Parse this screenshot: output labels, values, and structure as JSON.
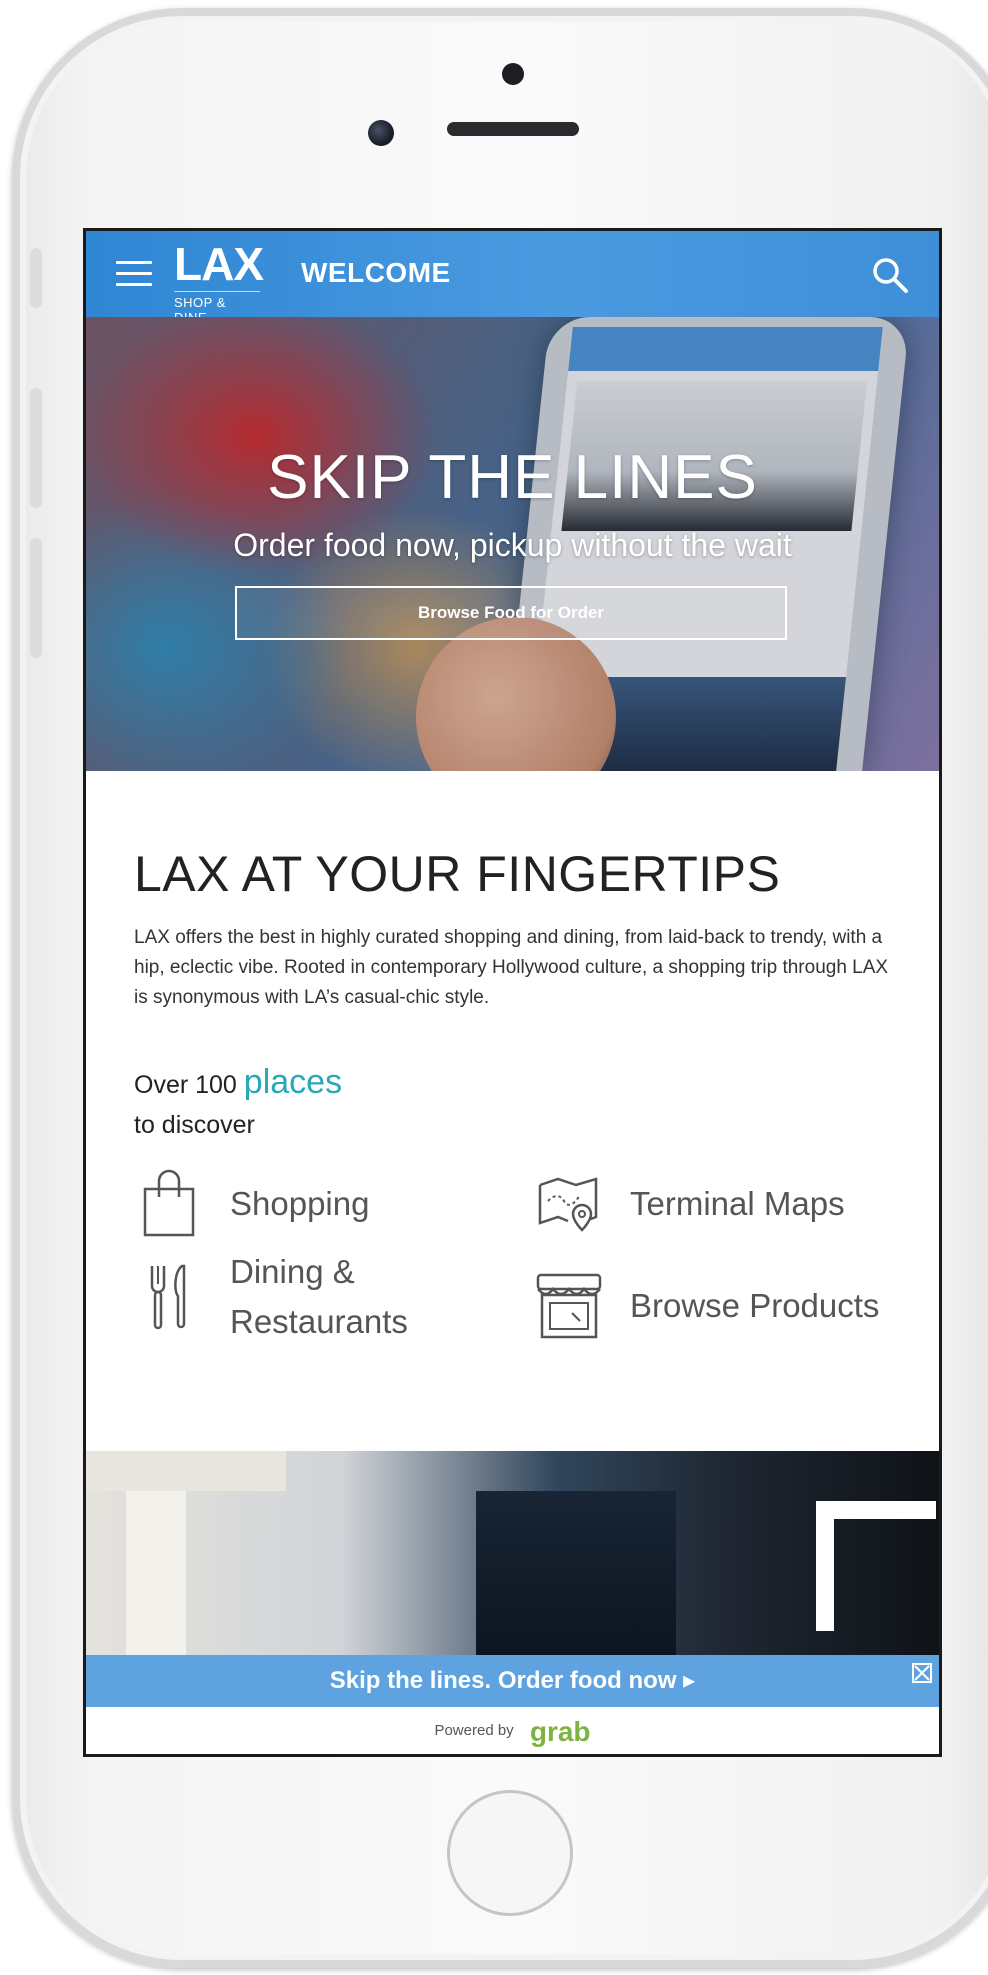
{
  "header": {
    "logo_main": "LAX",
    "logo_sub": "SHOP & DINE",
    "title": "WELCOME"
  },
  "hero": {
    "title": "SKIP THE LINES",
    "subtitle": "Order food now, pickup without the wait",
    "button_label": "Browse Food for Order"
  },
  "intro": {
    "title": "LAX AT YOUR FINGERTIPS",
    "body": "LAX offers the best in highly curated shopping and dining, from laid-back to trendy, with a hip, eclectic vibe. Rooted in contemporary Hollywood culture, a shopping trip through LAX is synonymous with LA’s casual-chic style.",
    "count_prefix": "Over 100",
    "count_accent": "places",
    "count_suffix": "to discover"
  },
  "categories": [
    {
      "label": "Shopping",
      "icon": "shopping-bag-icon"
    },
    {
      "label": "Terminal Maps",
      "icon": "map-icon"
    },
    {
      "label": "Dining & Restaurants",
      "icon": "fork-knife-icon"
    },
    {
      "label": "Browse Products",
      "icon": "storefront-icon"
    }
  ],
  "promo": {
    "text": "Skip the lines. Order food now ▸",
    "powered_by": "Powered by",
    "brand": "grab"
  },
  "colors": {
    "header_blue": "#3f8fd8",
    "accent_teal": "#2aa8b8",
    "promo_blue": "#5ea3e0",
    "grab_green": "#7cb342"
  }
}
